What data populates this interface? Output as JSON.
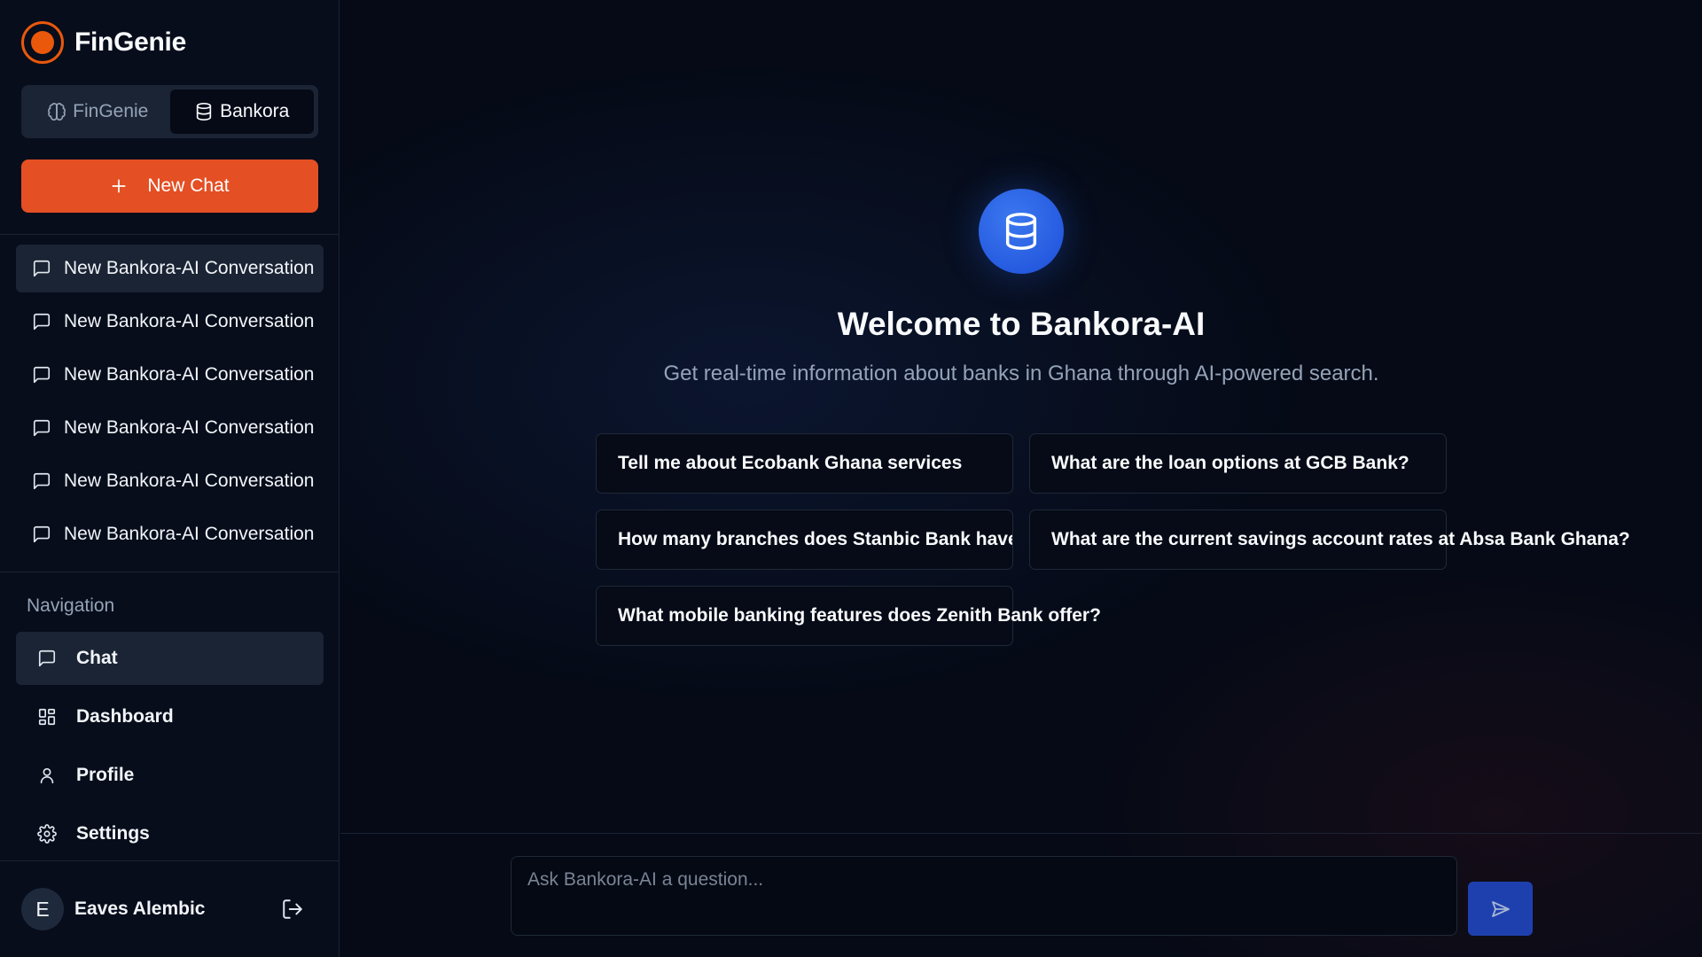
{
  "brand": {
    "name": "FinGenie"
  },
  "mode_toggle": {
    "fingenie_label": "FinGenie",
    "bankora_label": "Bankora"
  },
  "new_chat": {
    "label": "New Chat"
  },
  "conversations": [
    {
      "label": "New Bankora-AI Conversation"
    },
    {
      "label": "New Bankora-AI Conversation"
    },
    {
      "label": "New Bankora-AI Conversation"
    },
    {
      "label": "New Bankora-AI Conversation"
    },
    {
      "label": "New Bankora-AI Conversation"
    },
    {
      "label": "New Bankora-AI Conversation"
    }
  ],
  "navigation": {
    "heading": "Navigation",
    "items": [
      {
        "label": "Chat",
        "icon": "message-square-icon"
      },
      {
        "label": "Dashboard",
        "icon": "layout-grid-icon"
      },
      {
        "label": "Profile",
        "icon": "user-icon"
      },
      {
        "label": "Settings",
        "icon": "gear-icon"
      }
    ]
  },
  "user": {
    "initial": "E",
    "name": "Eaves Alembic"
  },
  "welcome": {
    "title": "Welcome to Bankora-AI",
    "subtitle": "Get real-time information about banks in Ghana through AI-powered search."
  },
  "suggestions": [
    "Tell me about Ecobank Ghana services",
    "What are the loan options at GCB Bank?",
    "How many branches does Stanbic Bank have in Ghana?",
    "What are the current savings account rates at Absa Bank Ghana?",
    "What mobile banking features does Zenith Bank offer?"
  ],
  "chat_input": {
    "placeholder": "Ask Bankora-AI a question..."
  },
  "colors": {
    "accent": "#e44f24",
    "primary": "#1d4ed8",
    "background": "#050a16"
  }
}
